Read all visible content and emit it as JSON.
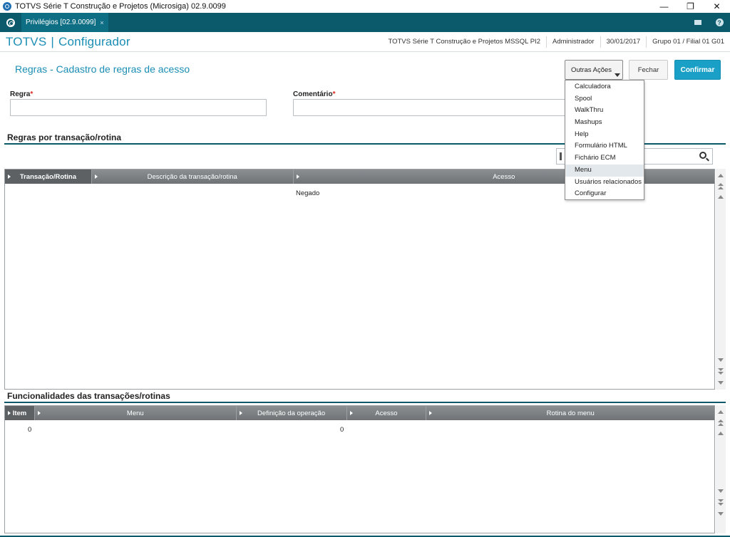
{
  "window": {
    "title": "TOTVS Série T Construção e Projetos (Microsiga) 02.9.0099",
    "controls": {
      "minimize": "—",
      "restore": "❐",
      "close": "✕"
    }
  },
  "tabbar": {
    "tab_label": "Privilégios [02.9.0099]",
    "tab_close": "×",
    "help_glyph": "?"
  },
  "header": {
    "brand_left": "TOTVS",
    "brand_sep": "|",
    "brand_right": "Configurador",
    "infos": [
      "TOTVS Série T Construção e Projetos MSSQL PI2",
      "Administrador",
      "30/01/2017",
      "Grupo 01 / Filial 01 G01"
    ]
  },
  "page": {
    "title": "Regras - Cadastro de regras de acesso",
    "buttons": {
      "outras_acoes": "Outras Ações",
      "fechar": "Fechar",
      "confirmar": "Confirmar"
    }
  },
  "form": {
    "regra_label": "Regra",
    "comentario_label": "Comentário",
    "required_mark": "*"
  },
  "dropdown": {
    "items": [
      "Calculadora",
      "Spool",
      "WalkThru",
      "Mashups",
      "Help",
      "Formulário HTML",
      "Fichário ECM",
      "Menu",
      "Usuários relacionados",
      "Configurar"
    ],
    "hovered": "Menu"
  },
  "section1": {
    "title": "Regras por transação/rotina",
    "columns": [
      "Transação/Rotina",
      "Descrição da transação/rotina",
      "Acesso"
    ],
    "rows": [
      {
        "transacao": "",
        "descricao": "",
        "acesso": "Negado"
      }
    ]
  },
  "section2": {
    "title": "Funcionalidades das transações/rotinas",
    "columns": [
      "Item",
      "Menu",
      "Definição da operação",
      "Acesso",
      "Rotina do menu"
    ],
    "rows": [
      {
        "item": "0",
        "menu": "",
        "definicao": "0",
        "acesso": "",
        "rotina": ""
      }
    ]
  },
  "colors": {
    "tabbar": "#0b5a6b",
    "accent": "#1b8eb5",
    "confirm": "#1aa0c6",
    "required": "#d9261c"
  }
}
